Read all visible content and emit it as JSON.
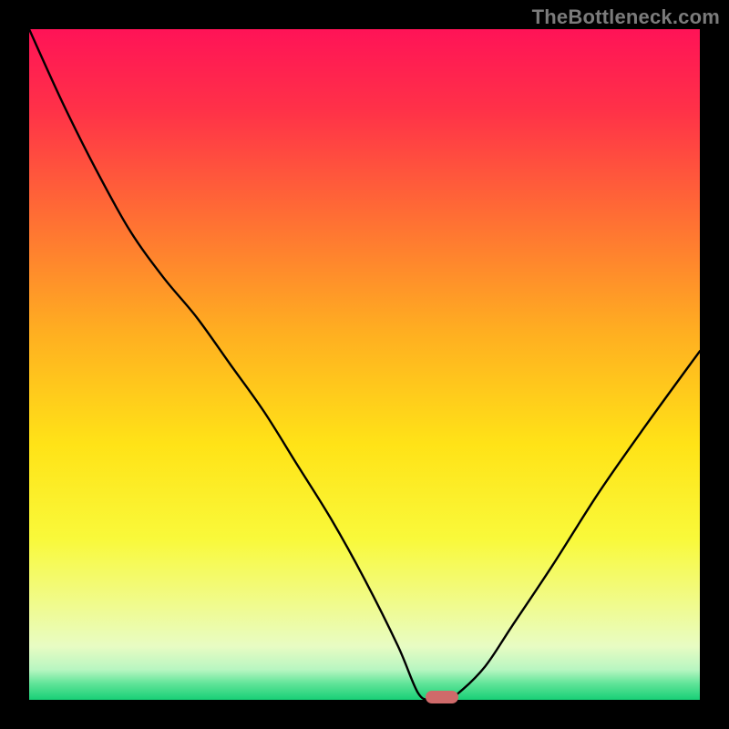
{
  "watermark": "TheBottleneck.com",
  "colors": {
    "gradient_stops": [
      {
        "offset": 0.0,
        "color": "#ff1357"
      },
      {
        "offset": 0.12,
        "color": "#ff3148"
      },
      {
        "offset": 0.28,
        "color": "#ff6e34"
      },
      {
        "offset": 0.45,
        "color": "#ffae21"
      },
      {
        "offset": 0.62,
        "color": "#ffe317"
      },
      {
        "offset": 0.76,
        "color": "#f9f93a"
      },
      {
        "offset": 0.86,
        "color": "#f0fb8f"
      },
      {
        "offset": 0.92,
        "color": "#e8fcc3"
      },
      {
        "offset": 0.955,
        "color": "#b8f6c1"
      },
      {
        "offset": 0.975,
        "color": "#63e59a"
      },
      {
        "offset": 1.0,
        "color": "#18cf76"
      }
    ],
    "curve_stroke": "#000000",
    "marker_fill": "#cf6a6a",
    "frame_bg": "#000000"
  },
  "chart_data": {
    "type": "line",
    "title": "",
    "xlabel": "",
    "ylabel": "",
    "xlim": [
      0,
      1
    ],
    "ylim": [
      0,
      1
    ],
    "grid": false,
    "series": [
      {
        "name": "bottleneck-curve",
        "x": [
          0.0,
          0.05,
          0.1,
          0.15,
          0.2,
          0.25,
          0.3,
          0.35,
          0.4,
          0.45,
          0.5,
          0.55,
          0.58,
          0.6,
          0.62,
          0.64,
          0.68,
          0.72,
          0.78,
          0.85,
          0.92,
          1.0
        ],
        "y": [
          1.0,
          0.89,
          0.79,
          0.7,
          0.63,
          0.57,
          0.5,
          0.43,
          0.35,
          0.27,
          0.18,
          0.08,
          0.01,
          0.0,
          0.0,
          0.01,
          0.05,
          0.11,
          0.2,
          0.31,
          0.41,
          0.52
        ]
      }
    ],
    "marker": {
      "x": 0.615,
      "y": 0.0
    }
  }
}
